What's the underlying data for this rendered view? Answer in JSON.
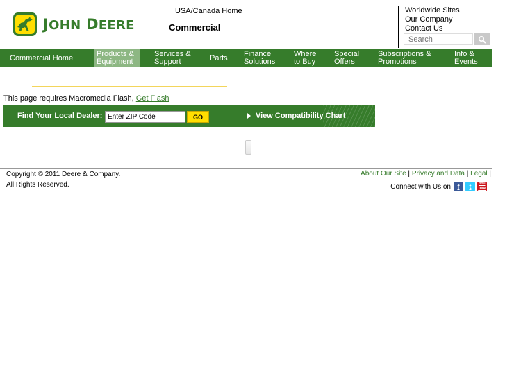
{
  "brand": {
    "name": "John Deere",
    "accent": "#367c2b"
  },
  "header": {
    "region_link": "USA/Canada Home",
    "section_title": "Commercial",
    "util_links": [
      "Worldwide Sites",
      "Our Company",
      "Contact Us"
    ],
    "search_placeholder": "Search"
  },
  "nav": {
    "items": [
      {
        "label": "Commercial Home",
        "active": false
      },
      {
        "label": "Products &\nEquipment",
        "active": true
      },
      {
        "label": "Services &\nSupport",
        "active": false
      },
      {
        "label": "Parts",
        "active": false
      },
      {
        "label": "Finance\nSolutions",
        "active": false
      },
      {
        "label": "Where\nto Buy",
        "active": false
      },
      {
        "label": "Special\nOffers",
        "active": false
      },
      {
        "label": "Subscriptions &\nPromotions",
        "active": false
      },
      {
        "label": "Info &\nEvents",
        "active": false
      }
    ]
  },
  "content": {
    "flash_message": "This page requires Macromedia Flash,",
    "flash_link": "Get Flash",
    "dealer": {
      "label": "Find Your Local Dealer:",
      "zip_value": "Enter ZIP Code",
      "go_label": "GO",
      "compat_link": "View Compatibility Chart"
    }
  },
  "footer": {
    "copyright_line1": "Copyright © 2011 Deere & Company.",
    "copyright_line2": "All Rights Reserved.",
    "links": [
      "About Our Site",
      "Privacy and Data",
      "Legal"
    ],
    "connect_label": "Connect with Us on",
    "social_icons": [
      "facebook-icon",
      "twitter-icon",
      "youtube-icon"
    ],
    "social_glyphs": {
      "facebook": "f",
      "twitter": "t",
      "youtube": "You Tube"
    }
  }
}
